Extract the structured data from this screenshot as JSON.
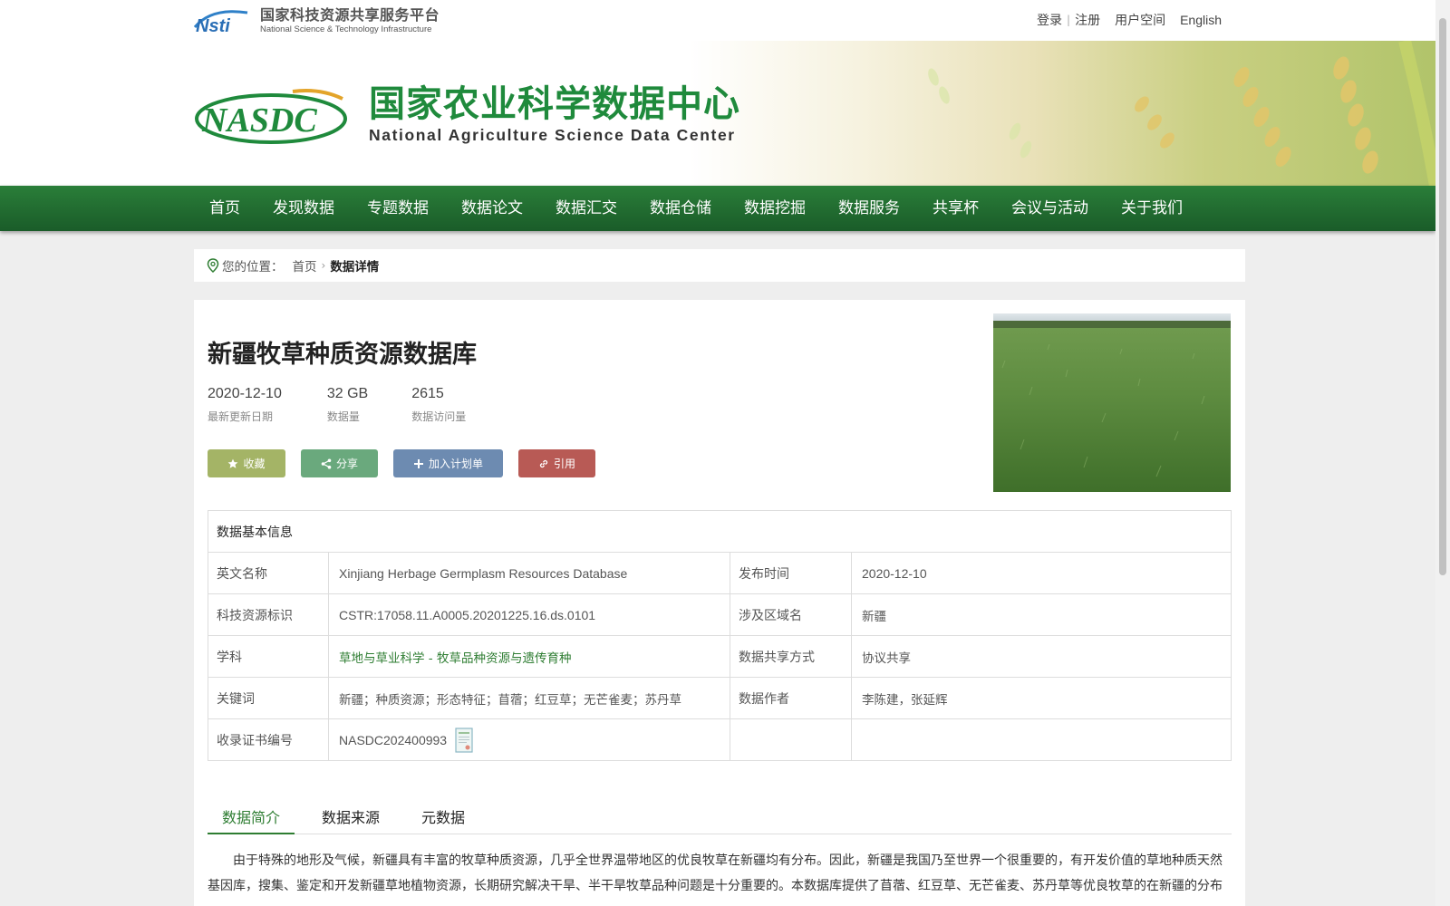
{
  "topbar": {
    "platform_cn": "国家科技资源共享服务平台",
    "platform_en": "National Science & Technology Infrastructure",
    "logo_text": "Nsti",
    "login": "登录",
    "register": "注册",
    "user_space": "用户空间",
    "english": "English"
  },
  "banner": {
    "logo_text": "NASDC",
    "title_cn": "国家农业科学数据中心",
    "title_en": "National Agriculture Science Data Center"
  },
  "nav": {
    "items": [
      "首页",
      "发现数据",
      "专题数据",
      "数据论文",
      "数据汇交",
      "数据仓储",
      "数据挖掘",
      "数据服务",
      "共享杯",
      "会议与活动",
      "关于我们"
    ]
  },
  "breadcrumb": {
    "prefix": "您的位置：",
    "home": "首页",
    "current": "数据详情"
  },
  "dataset": {
    "title": "新疆牧草种质资源数据库",
    "updated": "2020-12-10",
    "updated_label": "最新更新日期",
    "size": "32 GB",
    "size_label": "数据量",
    "visits": "2615",
    "visits_label": "数据访问量"
  },
  "actions": {
    "favorite": "收藏",
    "share": "分享",
    "add_plan": "加入计划单",
    "cite": "引用"
  },
  "info": {
    "header": "数据基本信息",
    "rows": [
      {
        "k1": "英文名称",
        "v1": "Xinjiang Herbage Germplasm Resources Database",
        "k2": "发布时间",
        "v2": "2020-12-10"
      },
      {
        "k1": "科技资源标识",
        "v1": "CSTR:17058.11.A0005.20201225.16.ds.0101",
        "k2": "涉及区域名",
        "v2": "新疆"
      },
      {
        "k1": "学科",
        "v1": "草地与草业科学 - 牧草品种资源与遗传育种",
        "k2": "数据共享方式",
        "v2": "协议共享"
      },
      {
        "k1": "关键词",
        "v1": "新疆；种质资源；形态特征；苜蓿；红豆草；无芒雀麦；苏丹草",
        "k2": "数据作者",
        "v2": "李陈建，张延辉"
      },
      {
        "k1": "收录证书编号",
        "v1": "NASDC202400993",
        "k2": "",
        "v2": ""
      }
    ]
  },
  "tabs": [
    "数据简介",
    "数据来源",
    "元数据"
  ],
  "intro": "由于特殊的地形及气候，新疆具有丰富的牧草种质资源，几乎全世界温带地区的优良牧草在新疆均有分布。因此，新疆是我国乃至世界一个很重要的，有开发价值的草地种质天然基因库，搜集、鉴定和开发新疆草地植物资源，长期研究解决干旱、半干旱牧草品种问题是十分重要的。本数据库提供了苜蓿、红豆草、无芒雀麦、苏丹草等优良牧草的在新疆的分布",
  "colors": {
    "nav_green": "#1f6b30",
    "title_green": "#1f8a3c",
    "fav": "#a4b466",
    "share": "#6aa97d",
    "plan": "#6d8bb1",
    "cite": "#b85a55"
  }
}
